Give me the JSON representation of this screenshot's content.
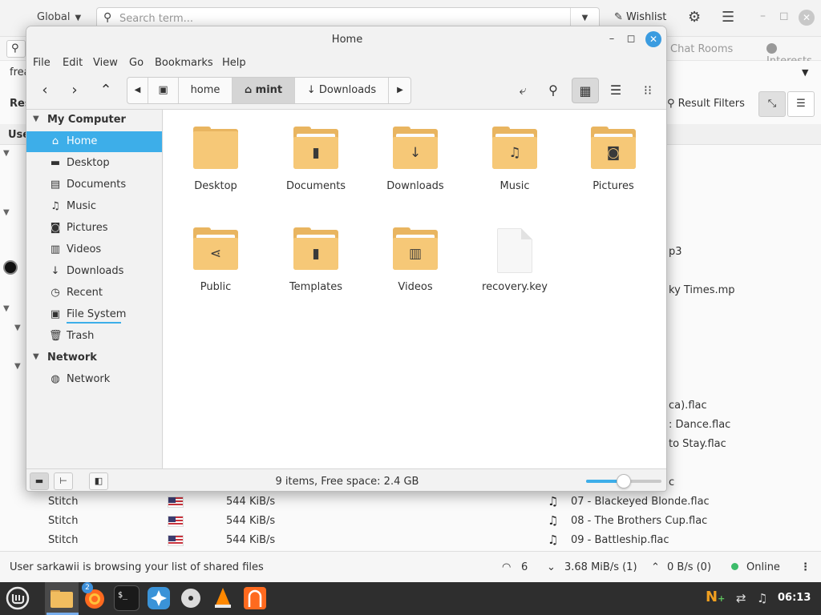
{
  "background_app": {
    "scope": "Global",
    "search_placeholder": "Search term...",
    "wishlist": "Wishlist",
    "tabs": {
      "chat_rooms": "Chat Rooms",
      "interests": "Interests"
    },
    "filter_fragment": "frea",
    "left_fragments": {
      "res": "Res",
      "use": "Use"
    },
    "result_filters": "Result Filters",
    "rows": [
      {
        "user": "Stitch",
        "speed": "544 KiB/s",
        "file": "07 - Blackeyed Blonde.flac"
      },
      {
        "user": "Stitch",
        "speed": "544 KiB/s",
        "file": "08 - The Brothers Cup.flac"
      },
      {
        "user": "Stitch",
        "speed": "544 KiB/s",
        "file": "09 - Battleship.flac"
      }
    ],
    "partial_files": [
      "p3",
      "ky Times.mp",
      "ca).flac",
      ": Dance.flac",
      "to Stay.flac",
      "c"
    ],
    "status": {
      "message": "User sarkawii is browsing your list of shared files",
      "connections": "6",
      "download": "3.68 MiB/s (1)",
      "upload": "0 B/s (0)",
      "online": "Online"
    },
    "colors": {
      "online": "#3dbc6a"
    }
  },
  "taskbar": {
    "clock": "06:13",
    "badge": "2"
  },
  "file_manager": {
    "title": "Home",
    "menu": [
      "File",
      "Edit",
      "View",
      "Go",
      "Bookmarks",
      "Help"
    ],
    "path": {
      "home": "home",
      "mint": "mint",
      "downloads": "Downloads"
    },
    "sidebar": {
      "my_computer": "My Computer",
      "network_header": "Network",
      "items": [
        "Home",
        "Desktop",
        "Documents",
        "Music",
        "Pictures",
        "Videos",
        "Downloads",
        "Recent",
        "File System",
        "Trash"
      ],
      "network_items": [
        "Network"
      ]
    },
    "files": [
      "Desktop",
      "Documents",
      "Downloads",
      "Music",
      "Pictures",
      "Public",
      "Templates",
      "Videos",
      "recovery.key"
    ],
    "status": "9 items, Free space: 2.4 GB",
    "zoom_level": 0.5,
    "colors": {
      "selection": "#3daee9",
      "folder": "#f6c877",
      "close": "#3b9ce0"
    }
  }
}
